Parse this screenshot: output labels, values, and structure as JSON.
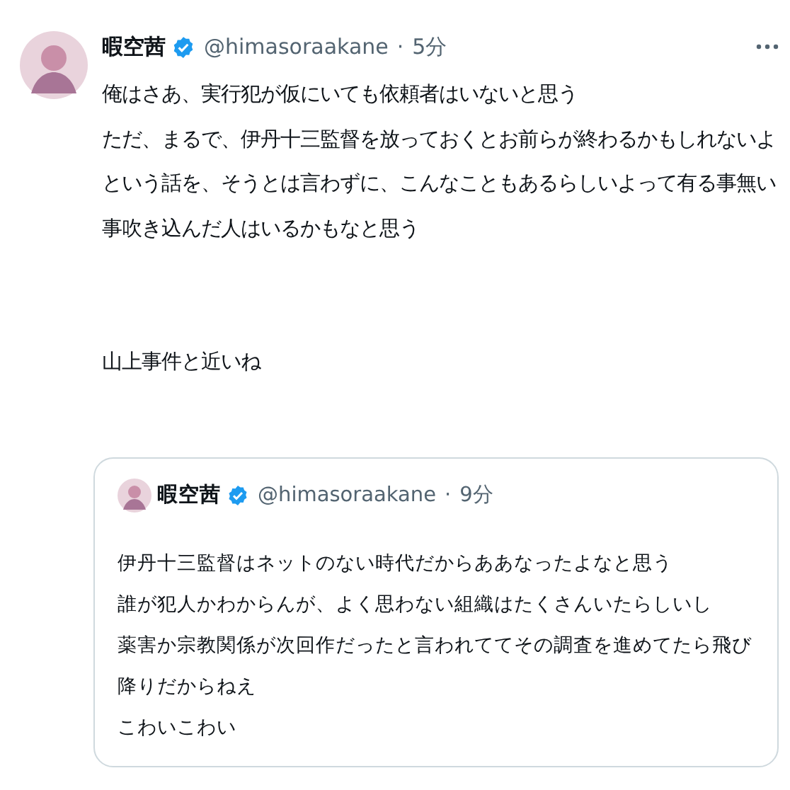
{
  "tweet": {
    "author": {
      "name": "暇空茜",
      "handle": "@himasoraakane",
      "separator": "·",
      "time": "5分",
      "verified": true
    },
    "paragraphs": [
      [
        "俺はさあ、実行犯が仮にいても依頼者はいないと思う",
        "ただ、まるで、伊丹十三監督を放っておくとお前らが終わるかもしれないよ",
        "という話を、そうとは言わずに、こんなこともあるらしいよって有る事無い",
        "事吹き込んだ人はいるかもなと思う"
      ],
      [
        "山上事件と近いね"
      ]
    ],
    "quote": {
      "author": {
        "name": "暇空茜",
        "handle": "@himasoraakane",
        "separator": "·",
        "time": "9分",
        "verified": true
      },
      "lines": [
        "伊丹十三監督はネットのない時代だからああなったよなと思う",
        "誰が犯人かわからんが、よく思わない組織はたくさんいたらしいし",
        "薬害か宗教関係が次回作だったと言われててその調査を進めてたら飛び",
        "降りだからねえ",
        "こわいこわい"
      ]
    }
  }
}
